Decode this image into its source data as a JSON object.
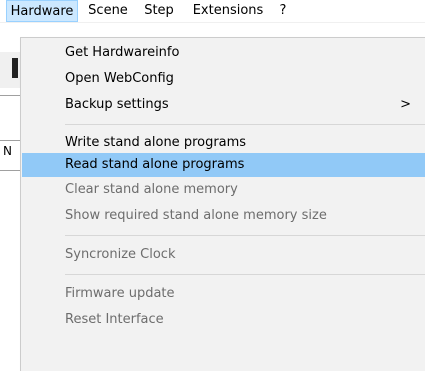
{
  "menubar": {
    "items": [
      {
        "label": "Hardware"
      },
      {
        "label": "Scene"
      },
      {
        "label": "Step"
      },
      {
        "label": "Extensions"
      },
      {
        "label": "?"
      }
    ]
  },
  "background": {
    "left_fragment_char": "N"
  },
  "dropdown": {
    "items": [
      {
        "label": "Get Hardwareinfo",
        "enabled": true
      },
      {
        "label": "Open WebConfig",
        "enabled": true
      },
      {
        "label": "Backup settings",
        "enabled": true,
        "submenu_arrow": ">"
      },
      {
        "label": "Write stand alone programs",
        "enabled": true
      },
      {
        "label": "Read stand alone programs",
        "enabled": true,
        "highlighted": true
      },
      {
        "label": "Clear stand alone memory",
        "enabled": false
      },
      {
        "label": "Show required stand alone memory size",
        "enabled": false
      },
      {
        "label": "Syncronize Clock",
        "enabled": false
      },
      {
        "label": "Firmware update",
        "enabled": false
      },
      {
        "label": "Reset Interface",
        "enabled": false
      }
    ]
  },
  "colors": {
    "menubar_open_bg": "#cce8ff",
    "highlight_bg": "#91c9f7",
    "dropdown_bg": "#f2f2f2",
    "disabled_text": "#6d6d6d"
  }
}
